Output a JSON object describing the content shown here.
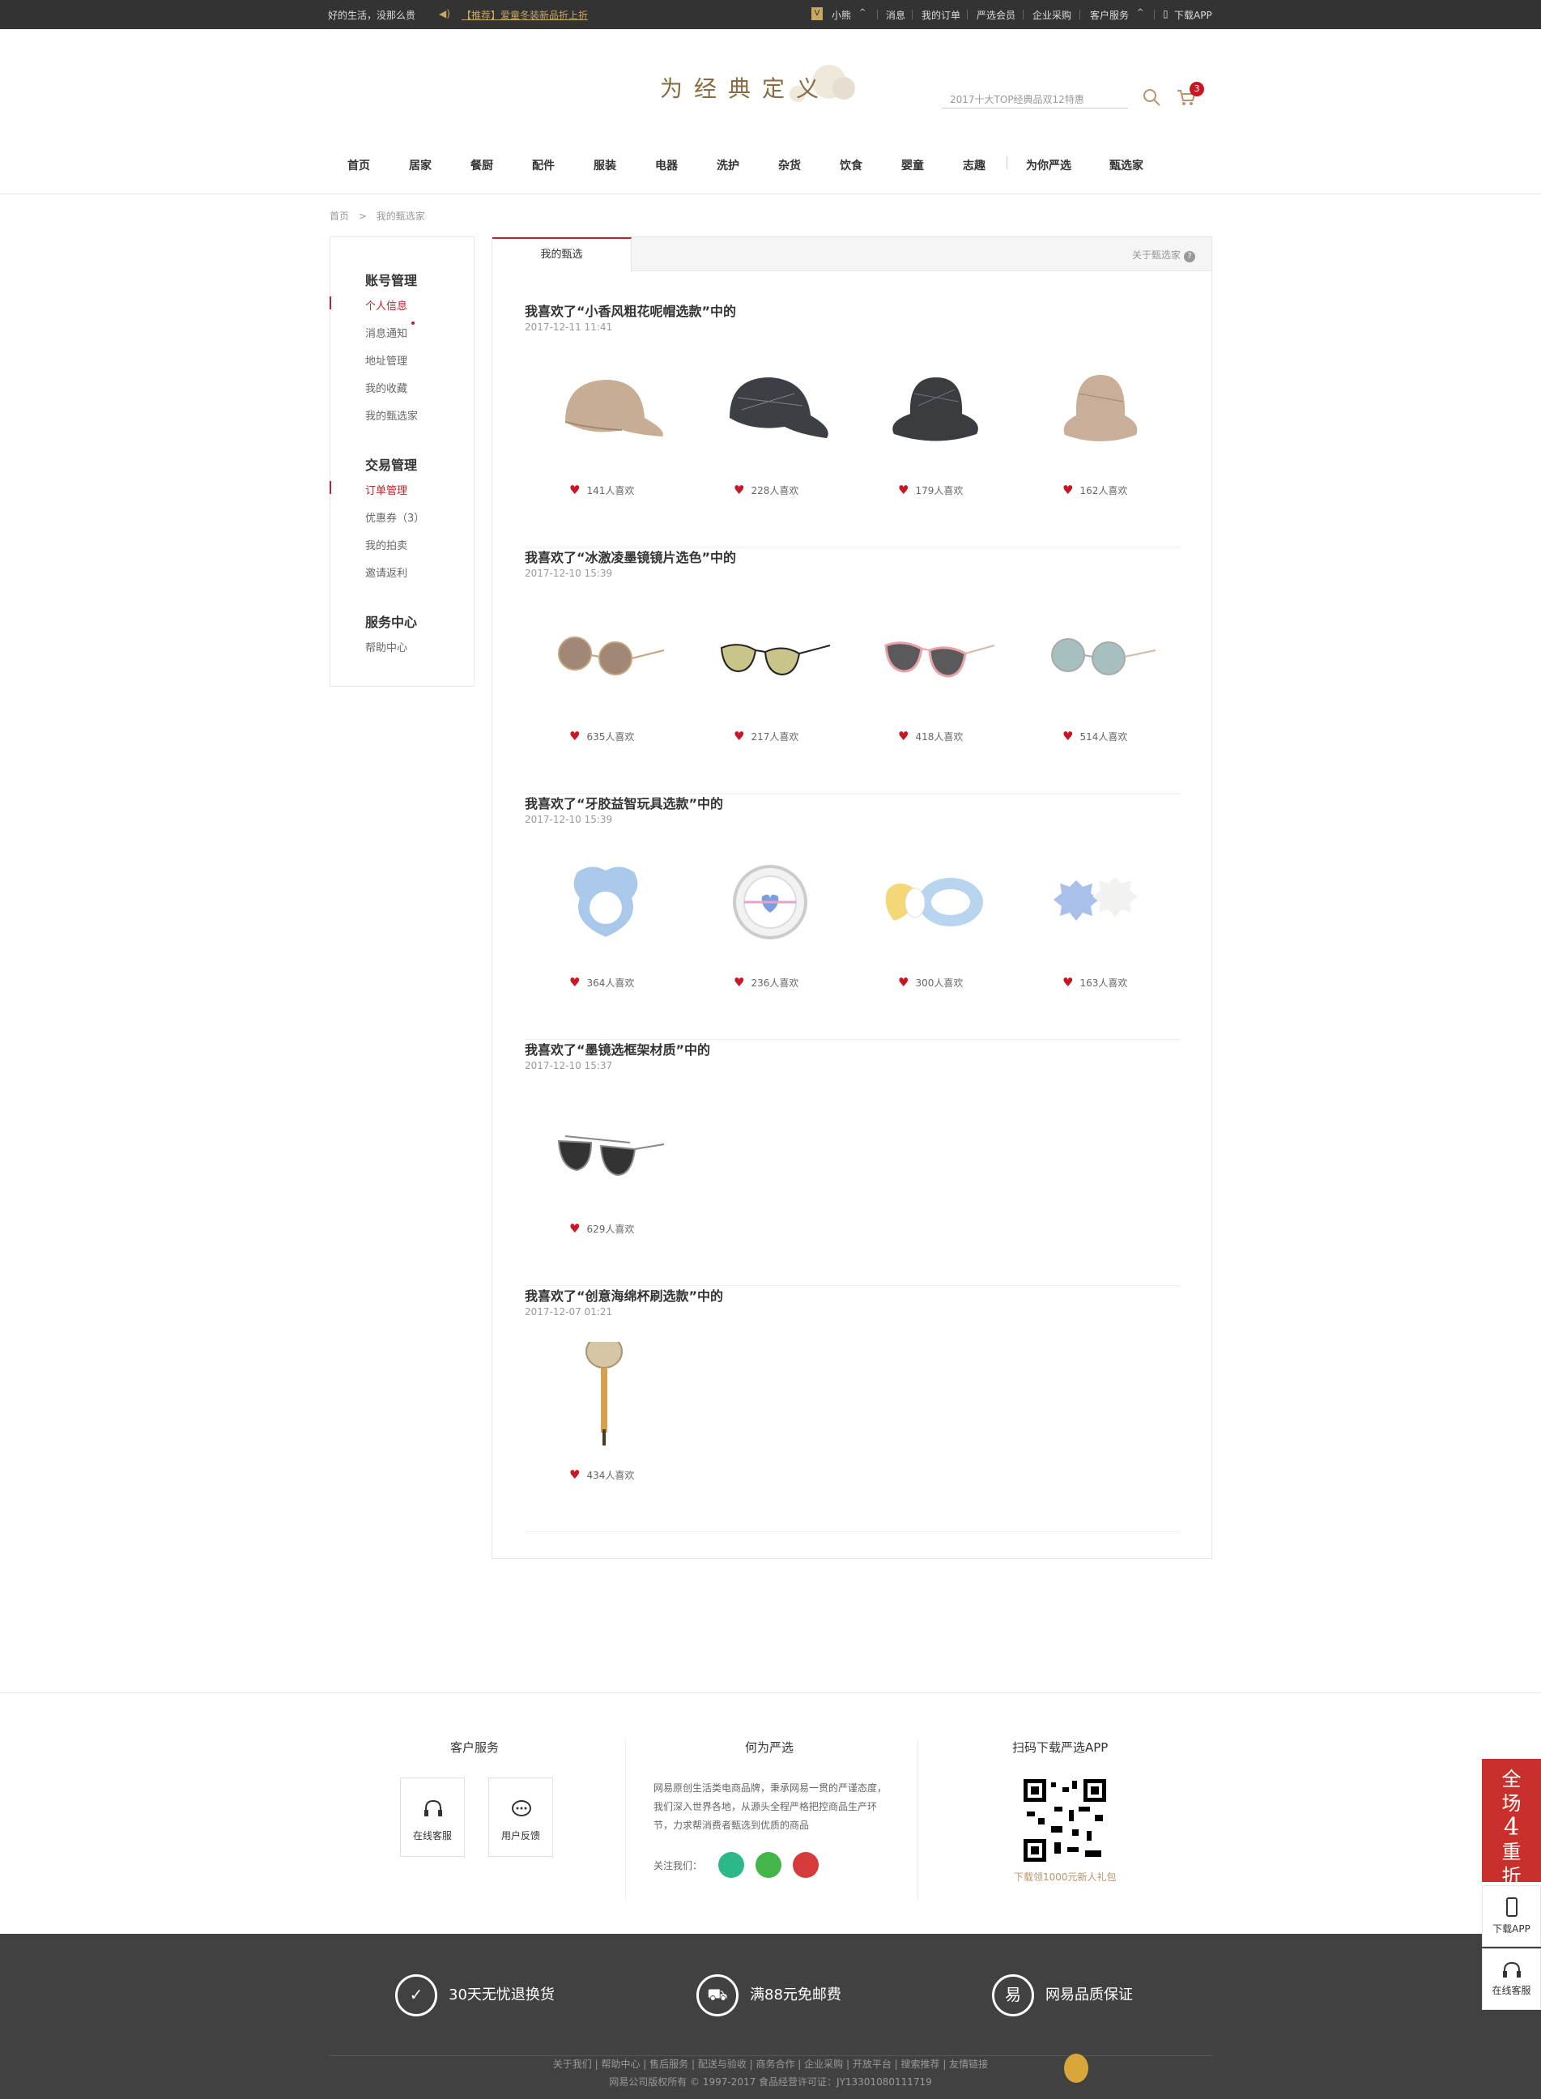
{
  "topbar": {
    "slogan": "好的生活，没那么贵",
    "promo": "【推荐】爱童冬装新品折上折",
    "user": "小熊",
    "links": [
      "消息",
      "我的订单",
      "严选会员",
      "企业采购",
      "客户服务",
      "下载APP"
    ]
  },
  "header": {
    "slogan": "为经典定义",
    "search_placeholder": "2017十大TOP经典品双12特惠",
    "cart_count": "3"
  },
  "nav": [
    "首页",
    "居家",
    "餐厨",
    "配件",
    "服装",
    "电器",
    "洗护",
    "杂货",
    "饮食",
    "婴童",
    "志趣",
    "为你严选",
    "甄选家"
  ],
  "breadcrumb": {
    "home": "首页",
    "sep": ">",
    "current": "我的甄选家"
  },
  "side": {
    "h1": "账号管理",
    "items1": [
      "个人信息",
      "消息通知",
      "地址管理",
      "我的收藏",
      "我的甄选家"
    ],
    "h2": "交易管理",
    "items2": [
      "订单管理",
      "优惠券（3）",
      "我的拍卖",
      "邀请返利"
    ],
    "h3": "服务中心",
    "items3": [
      "帮助中心"
    ]
  },
  "main": {
    "tab": "我的甄选",
    "about": "关于甄选家",
    "groups": [
      {
        "title": "我喜欢了“小香风粗花呢帽选款”中的",
        "date": "2017-12-11 11:41",
        "likes": [
          "141人喜欢",
          "228人喜欢",
          "179人喜欢",
          "162人喜欢"
        ]
      },
      {
        "title": "我喜欢了“冰激凌墨镜镜片选色”中的",
        "date": "2017-12-10 15:39",
        "likes": [
          "635人喜欢",
          "217人喜欢",
          "418人喜欢",
          "514人喜欢"
        ]
      },
      {
        "title": "我喜欢了“牙胶益智玩具选款”中的",
        "date": "2017-12-10 15:39",
        "likes": [
          "364人喜欢",
          "236人喜欢",
          "300人喜欢",
          "163人喜欢"
        ]
      },
      {
        "title": "我喜欢了“墨镜选框架材质”中的",
        "date": "2017-12-10 15:37",
        "likes": [
          "629人喜欢"
        ]
      },
      {
        "title": "我喜欢了“创意海绵杯刷选款”中的",
        "date": "2017-12-07 01:21",
        "likes": [
          "434人喜欢"
        ]
      }
    ]
  },
  "footer": {
    "service_title": "客户服务",
    "online": "在线客服",
    "feedback": "用户反馈",
    "about_title": "何为严选",
    "about_text": "网易原创生活类电商品牌，秉承网易一贯的严谨态度，我们深入世界各地，从源头全程严格把控商品生产环节，力求帮消费者甄选到优质的商品",
    "follow": "关注我们：",
    "app_title": "扫码下载严选APP",
    "app_sub": "下载领1000元新人礼包",
    "guarantees": [
      "30天无忧退换货",
      "满88元免邮费",
      "网易品质保证"
    ],
    "links": "关于我们  |  帮助中心  |  售后服务  |  配送与验收  |  商务合作  |  企业采购  |  开放平台  |  搜索推荐  |  友情链接",
    "copyright": "网易公司版权所有 © 1997-2017   食品经营许可证：JY13301080111719"
  },
  "float": {
    "promo": [
      "全",
      "场",
      "4",
      "重",
      "折"
    ],
    "download": "下载APP",
    "service": "在线客服"
  }
}
